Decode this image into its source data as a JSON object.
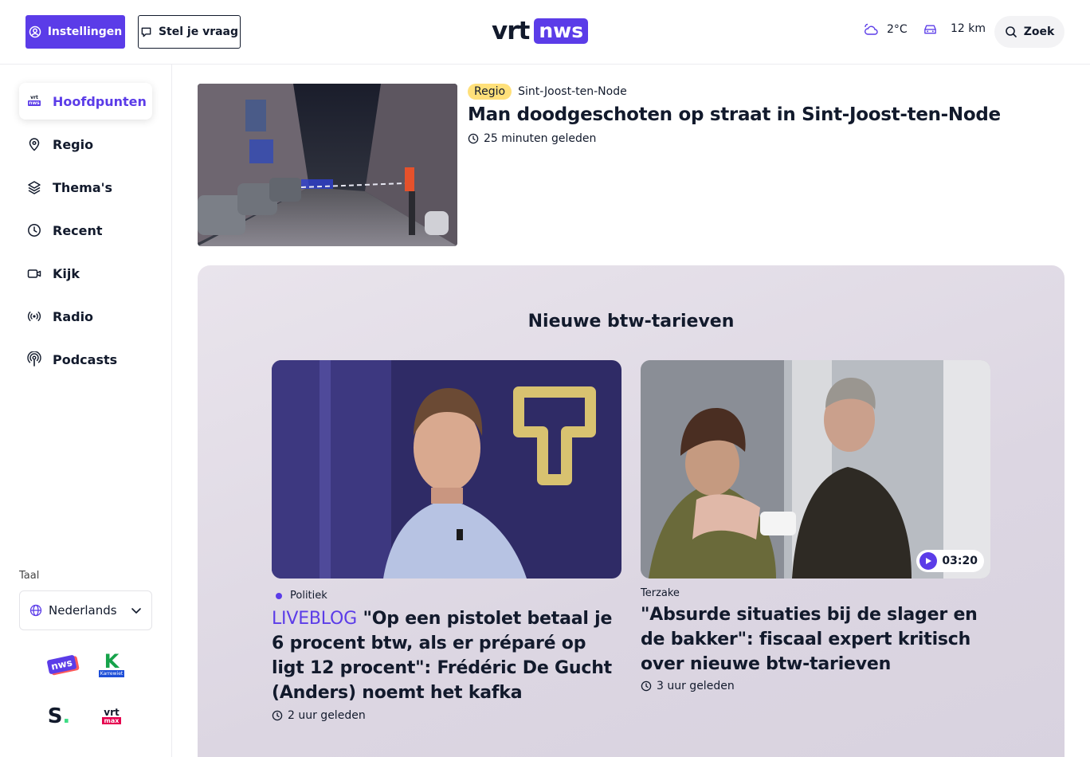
{
  "header": {
    "settings_label": "Instellingen",
    "ask_label": "Stel je vraag",
    "logo_vrt": "vrt",
    "logo_nws": "nws",
    "temperature": "2°C",
    "traffic": "12 km",
    "search_label": "Zoek"
  },
  "sidebar": {
    "items": [
      {
        "label": "Hoofdpunten",
        "icon": "vrt-nws-logo-icon"
      },
      {
        "label": "Regio",
        "icon": "location-pin-icon"
      },
      {
        "label": "Thema's",
        "icon": "layers-icon"
      },
      {
        "label": "Recent",
        "icon": "clock-icon"
      },
      {
        "label": "Kijk",
        "icon": "video-camera-icon"
      },
      {
        "label": "Radio",
        "icon": "broadcast-icon"
      },
      {
        "label": "Podcasts",
        "icon": "podcast-icon"
      }
    ],
    "mini_logo_top": "vrt",
    "mini_logo_bottom": "nws",
    "language_label": "Taal",
    "language_value": "Nederlands",
    "brands": {
      "nws": "nws",
      "ketnet": "K",
      "ketnet_sub": "Karrewiet",
      "sporza": "S",
      "sporza_dot": ".",
      "vrtmax_top": "vrt",
      "vrtmax_bottom": "max"
    }
  },
  "lead_article": {
    "badge": "Regio",
    "location": "Sint-Joost-ten-Node",
    "title": "Man doodgeschoten op straat in Sint-Joost-ten-Node",
    "time": "25 minuten geleden"
  },
  "feature": {
    "title": "Nieuwe btw-tarieven",
    "cards": [
      {
        "category": "Politiek",
        "prefix": "LIVEBLOG",
        "title": "\"Op een pistolet betaal je 6 procent btw, als er préparé op ligt 12 procent\": Frédéric De Gucht (Anders) noemt het kafka",
        "time": "2 uur geleden"
      },
      {
        "category": "Terzake",
        "title": "\"Absurde situaties bij de slager en de bakker\": fiscaal expert kritisch over nieuwe btw-tarieven",
        "time": "3 uur geleden",
        "duration": "03:20"
      }
    ]
  },
  "colors": {
    "accent": "#5b3ce8",
    "text": "#121a2c",
    "badge_regio": "#ffe07a"
  }
}
